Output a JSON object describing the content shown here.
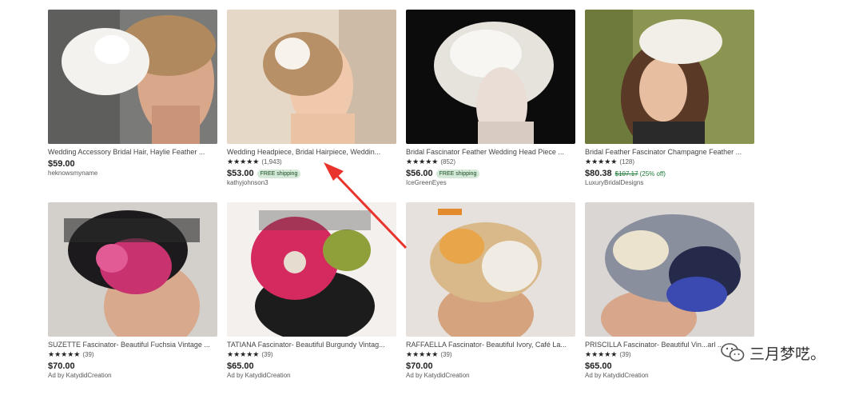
{
  "listings": [
    {
      "title": "Wedding Accessory Bridal Hair, Haylie Feather ...",
      "stars": "",
      "reviews": "",
      "price": "$59.00",
      "badge": "",
      "old_price": "",
      "discount": "",
      "shop": "heknowsmyname",
      "bg": "#6f6f6e"
    },
    {
      "title": "Wedding Headpiece, Bridal Hairpiece, Weddin...",
      "stars": "★★★★★",
      "reviews": "(1,943)",
      "price": "$53.00",
      "badge": "FREE shipping",
      "old_price": "",
      "discount": "",
      "shop": "kathyjohnson3",
      "bg": "#d8c5ae"
    },
    {
      "title": "Bridal Fascinator Feather Wedding Head Piece ...",
      "stars": "★★★★★",
      "reviews": "(852)",
      "price": "$56.00",
      "badge": "FREE shipping",
      "old_price": "",
      "discount": "",
      "shop": "IceGreenEyes",
      "bg": "#111111"
    },
    {
      "title": "Bridal Feather Fascinator Champagne Feather ...",
      "stars": "★★★★★",
      "reviews": "(128)",
      "price": "$80.38",
      "badge": "",
      "old_price": "$107.17",
      "discount": "(25% off)",
      "shop": "LuxuryBridalDesigns",
      "bg": "#88904e"
    },
    {
      "title": "SUZETTE Fascinator- Beautiful Fuchsia Vintage ...",
      "stars": "★★★★★",
      "reviews": "(39)",
      "price": "$70.00",
      "badge": "",
      "old_price": "",
      "discount": "",
      "shop": "Ad by KatydidCreation",
      "bg": "#cfcac6"
    },
    {
      "title": "TATIANA Fascinator- Beautiful Burgundy Vintag...",
      "stars": "★★★★★",
      "reviews": "(39)",
      "price": "$65.00",
      "badge": "",
      "old_price": "",
      "discount": "",
      "shop": "Ad by KatydidCreation",
      "bg": "#f2efec"
    },
    {
      "title": "RAFFAELLA Fascinator- Beautiful Ivory, Café La...",
      "stars": "★★★★★",
      "reviews": "(39)",
      "price": "$70.00",
      "badge": "",
      "old_price": "",
      "discount": "",
      "shop": "Ad by KatydidCreation",
      "bg": "#e4ded9"
    },
    {
      "title": "PRISCILLA Fascinator- Beautiful Vin...arl ...",
      "stars": "★★★★★",
      "reviews": "(39)",
      "price": "$65.00",
      "badge": "",
      "old_price": "",
      "discount": "",
      "shop": "Ad by KatydidCreation",
      "bg": "#d7d4d2"
    }
  ],
  "annotation": {
    "color": "#e8342c"
  },
  "watermark": {
    "text": "三月梦呓",
    "suffix": "。"
  }
}
